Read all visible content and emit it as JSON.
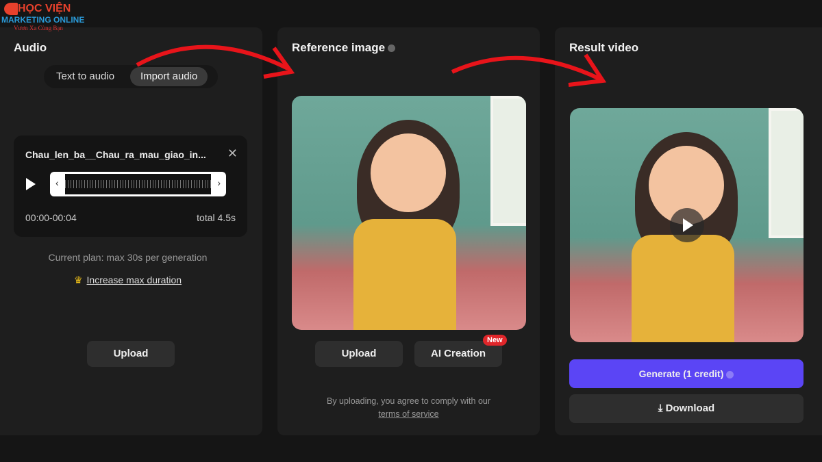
{
  "logo": {
    "line1": "HỌC VIỆN",
    "line2": "MARKETING ONLINE",
    "line3": "Vươn Xa Cùng Bạn"
  },
  "audio": {
    "title": "Audio",
    "tabs": [
      {
        "label": "Text to audio",
        "active": false
      },
      {
        "label": "Import audio",
        "active": true
      }
    ],
    "file": {
      "name": "Chau_len_ba__Chau_ra_mau_giao_in...",
      "range": "00:00-00:04",
      "total": "total 4.5s"
    },
    "plan": "Current plan: max 30s per generation",
    "increase": "Increase max duration",
    "upload": "Upload"
  },
  "reference": {
    "title": "Reference image",
    "upload": "Upload",
    "ai_creation": "AI Creation",
    "new_badge": "New",
    "note": "By uploading, you agree to comply with our",
    "terms": "terms of service"
  },
  "result": {
    "title": "Result video",
    "generate": "Generate (1 credit)",
    "download": "Download"
  },
  "colors": {
    "accent": "#5b45f5",
    "badge": "#e0262a",
    "arrow": "#e8141a"
  }
}
